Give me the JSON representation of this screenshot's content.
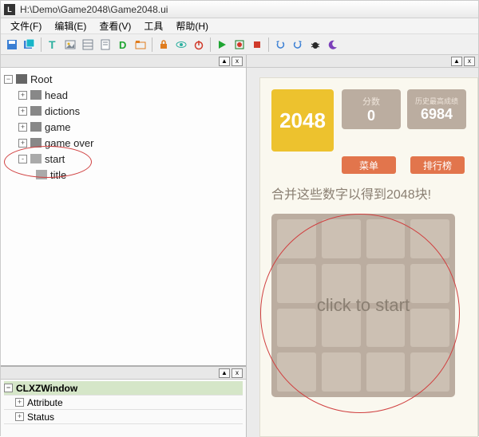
{
  "window": {
    "icon_label": "L",
    "title": "H:\\Demo\\Game2048\\Game2048.ui"
  },
  "menus": [
    "文件(F)",
    "编辑(E)",
    "查看(V)",
    "工具",
    "帮助(H)"
  ],
  "toolbar": {
    "colors": {
      "blue": "#3a7fd4",
      "cyan": "#18b5c8",
      "teal": "#2eb0a0",
      "grey": "#7b8692",
      "green": "#1fa532",
      "dgreen": "#0f7a1e",
      "orange": "#e07c1e",
      "red": "#d03a2a",
      "dark": "#2a2a2a",
      "purple": "#7c3fba",
      "yellow": "#e0b020"
    }
  },
  "tree": {
    "root": "Root",
    "children": [
      {
        "label": "head",
        "exp": "+"
      },
      {
        "label": "dictions",
        "exp": "+"
      },
      {
        "label": "game",
        "exp": "+"
      },
      {
        "label": "game over",
        "exp": "+"
      },
      {
        "label": "start",
        "exp": "-",
        "children": [
          {
            "label": "title"
          }
        ]
      }
    ]
  },
  "properties": {
    "class_name": "CLXZWindow",
    "rows": [
      "Attribute",
      "Status"
    ]
  },
  "preview": {
    "logo": "2048",
    "score": {
      "label": "分数",
      "value": "0"
    },
    "best": {
      "label": "历史最高成绩",
      "value": "6984"
    },
    "menu_btn": "菜单",
    "rank_btn": "排行榜",
    "instruction": "合并这些数字以得到2048块!",
    "overlay": "click to start"
  },
  "panel_controls": {
    "maximize": "▲",
    "close": "x"
  }
}
